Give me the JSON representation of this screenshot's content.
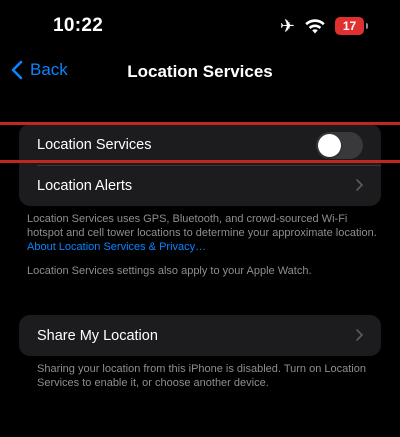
{
  "status_bar": {
    "time": "10:22",
    "battery_level": "17",
    "airplane_icon": "airplane-icon",
    "wifi_icon": "wifi-icon"
  },
  "nav": {
    "back_label": "Back",
    "title": "Location Services"
  },
  "location_group": {
    "location_services_label": "Location Services",
    "location_services_on": false,
    "location_alerts_label": "Location Alerts"
  },
  "location_footnote": {
    "text": "Location Services uses GPS, Bluetooth, and crowd-sourced Wi-Fi hotspot and cell tower locations to determine your approximate location. ",
    "link": "About Location Services & Privacy…",
    "watch_note": "Location Services settings also apply to your Apple Watch."
  },
  "share_group": {
    "share_label": "Share My Location"
  },
  "share_footnote": {
    "text": "Sharing your location from this iPhone is disabled. Turn on Location Services to enable it, or choose another device."
  },
  "colors": {
    "accent": "#0a84ff",
    "highlight": "#c0281f",
    "battery": "#e0302f"
  }
}
